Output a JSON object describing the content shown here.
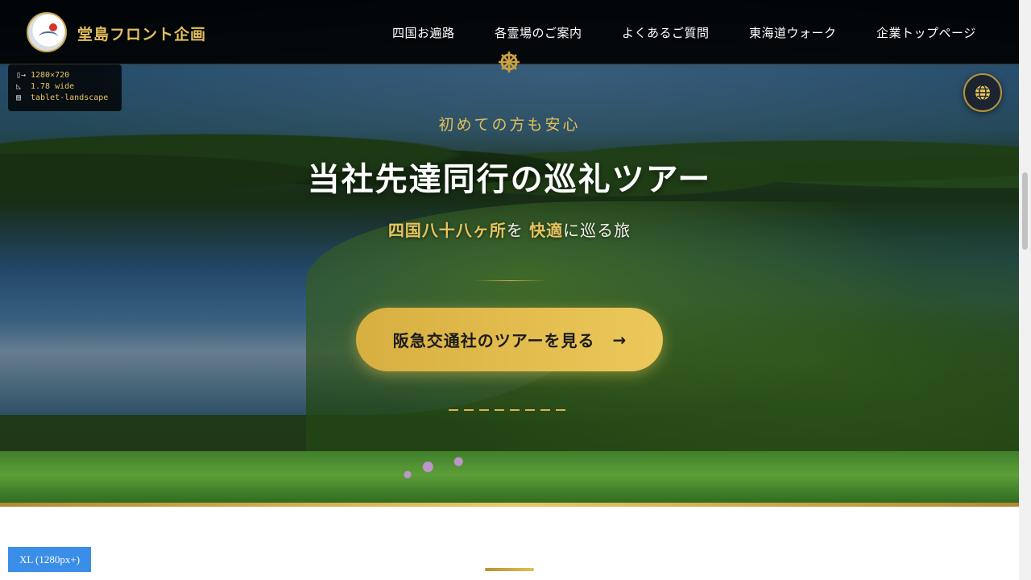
{
  "site": {
    "logo_text": "堂島フロント企画",
    "nav": [
      {
        "label": "四国お遍路"
      },
      {
        "label": "各霊場のご案内"
      },
      {
        "label": "よくあるご質問"
      },
      {
        "label": "東海道ウォーク"
      },
      {
        "label": "企業トップページ"
      }
    ]
  },
  "viewport_info": {
    "size": "1280×720",
    "ratio": "1.78 wide",
    "device": "tablet-landscape"
  },
  "hero": {
    "kicker": "初めての方も安心",
    "headline": "当社先達同行の巡礼ツアー",
    "subline": {
      "part1": "四国八十八ヶ所",
      "part2": "を ",
      "part3": "快適",
      "part4": "に巡る旅"
    },
    "cta_label": "阪急交通社のツアーを見る",
    "cta_arrow": "→"
  },
  "icons": {
    "dharma_wheel": "dharma-wheel-icon",
    "globe": "globe-icon",
    "arrow": "arrow-right-icon"
  },
  "breakpoint_badge": "XL (1280px+)",
  "colors": {
    "gold": "#e2bf5b",
    "header_bg": "#000000",
    "cta_gradient_start": "#d7af40",
    "cta_gradient_end": "#ecc85a",
    "badge_blue": "#3a8ee8"
  }
}
